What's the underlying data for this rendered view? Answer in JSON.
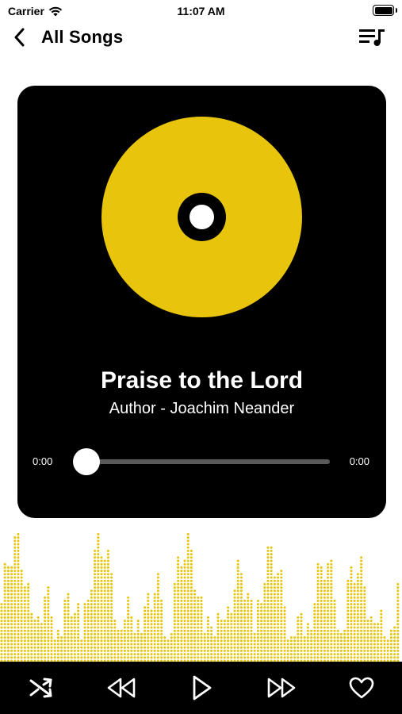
{
  "status_bar": {
    "carrier": "Carrier",
    "time": "11:07 AM"
  },
  "nav": {
    "title": "All Songs",
    "back_icon": "chevron-left-icon",
    "queue_icon": "playlist-music-icon"
  },
  "player": {
    "song_title": "Praise to the Lord",
    "song_author": "Author - Joachim Neander",
    "time_current": "0:00",
    "time_total": "0:00",
    "progress": 0
  },
  "controls": {
    "icons": [
      "shuffle-icon",
      "rewind-icon",
      "play-icon",
      "fast-forward-icon",
      "heart-icon"
    ]
  },
  "colors": {
    "accent": "#e8c40c",
    "card": "#000000",
    "track": "#5a5a5a"
  }
}
